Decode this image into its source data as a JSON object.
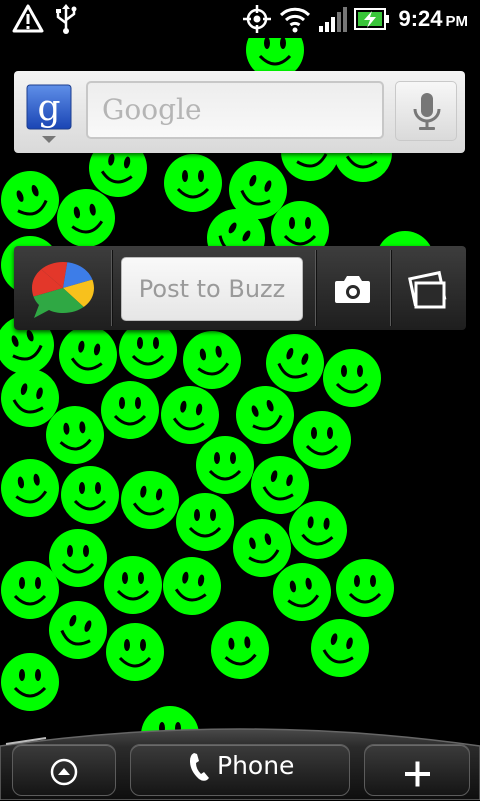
{
  "status_bar": {
    "icons": [
      "warning-icon",
      "usb-icon",
      "gps-icon",
      "wifi-icon",
      "signal-icon",
      "battery-charging-icon"
    ],
    "time": "9:24",
    "ampm": "PM"
  },
  "search_widget": {
    "logo_letter": "g",
    "placeholder": "Google",
    "mic_icon": "microphone-icon"
  },
  "buzz_widget": {
    "placeholder": "Post to Buzz",
    "camera_icon": "camera-icon",
    "gallery_icon": "photo-gallery-icon"
  },
  "dock": {
    "apps_icon": "chevron-up-icon",
    "phone_label": "Phone",
    "phone_icon": "phone-handset-icon",
    "add_label": "+"
  },
  "wallpaper": {
    "type": "green smiley faces",
    "color": "#00ff00"
  }
}
